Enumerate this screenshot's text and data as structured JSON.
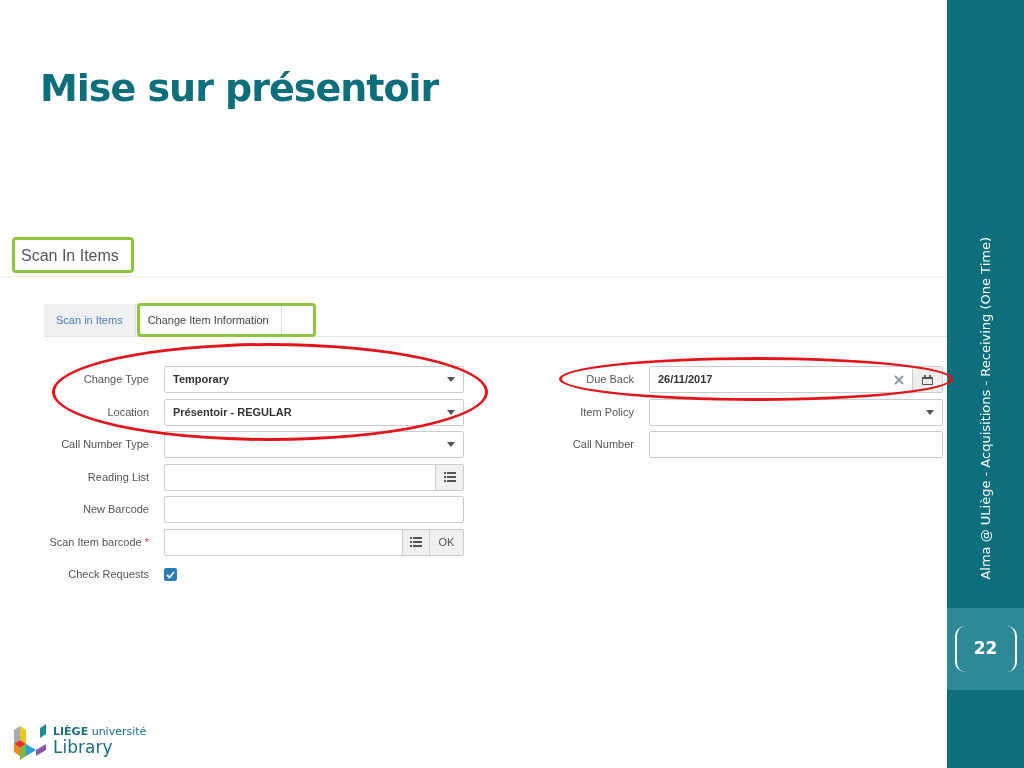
{
  "slide": {
    "title": "Mise sur présentoir",
    "side_label": "Alma @ ULiège - Acquisitions - Receiving (One Time)",
    "page_number": "22",
    "logo": {
      "line_1": "**LIÈGE** université",
      "line_2": "Library"
    }
  },
  "screen": {
    "page_title": "Scan In Items",
    "tabs": [
      {
        "label": "Scan in Items",
        "selected": false
      },
      {
        "label": "Change Item Information",
        "selected": true
      }
    ],
    "left_fields": [
      {
        "label": "Change Type",
        "kind": "select",
        "value": "Temporary"
      },
      {
        "label": "Location",
        "kind": "select",
        "value": "Présentoir - REGULAR"
      },
      {
        "label": "Call Number Type",
        "kind": "select"
      },
      {
        "label": "Reading List",
        "kind": "list"
      },
      {
        "label": "New Barcode",
        "kind": "text"
      },
      {
        "label": "Scan Item barcode",
        "kind": "scan",
        "required_mark": "*",
        "button": "OK"
      },
      {
        "label": "Check Requests",
        "kind": "checkbox",
        "checked": true
      }
    ],
    "right_fields": [
      {
        "label": "Due Back",
        "kind": "date",
        "value": "26/11/2017"
      },
      {
        "label": "Item Policy",
        "kind": "select"
      },
      {
        "label": "Call Number",
        "kind": "text"
      }
    ]
  },
  "annotations": [
    {
      "kind": "ellipse",
      "color": "#e3151a"
    },
    {
      "kind": "ellipse",
      "color": "#e3151a"
    },
    {
      "kind": "frame",
      "color": "#8cc63f"
    },
    {
      "kind": "frame",
      "color": "#8cc63f"
    }
  ]
}
